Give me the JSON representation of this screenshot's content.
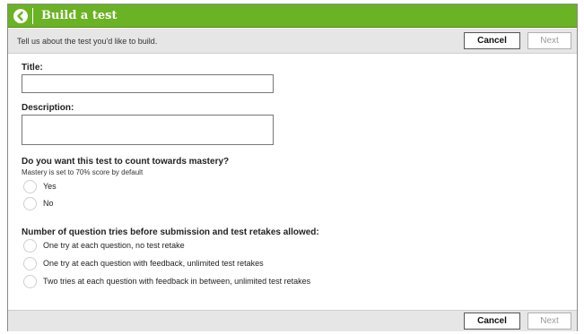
{
  "window": {
    "title": "Build a test"
  },
  "toolbar": {
    "hint": "Tell us about the test you'd like to build.",
    "cancel_label": "Cancel",
    "next_label": "Next"
  },
  "form": {
    "title_label": "Title:",
    "title_value": "",
    "description_label": "Description:",
    "description_value": "",
    "mastery": {
      "question": "Do you want this test to count towards mastery?",
      "note": "Mastery is set to 70% score by default",
      "options": [
        "Yes",
        "No"
      ]
    },
    "tries": {
      "question": "Number of question tries before submission and test retakes allowed:",
      "options": [
        "One try at each question, no test retake",
        "One try at each question with feedback, unlimited test retakes",
        "Two tries at each question with feedback in between, unlimited test retakes"
      ]
    }
  },
  "footer": {
    "cancel_label": "Cancel",
    "next_label": "Next"
  },
  "icons": {
    "back": "back-arrow-icon"
  },
  "colors": {
    "header_green": "#6ab324",
    "toolbar_gray": "#e6e6e6"
  }
}
